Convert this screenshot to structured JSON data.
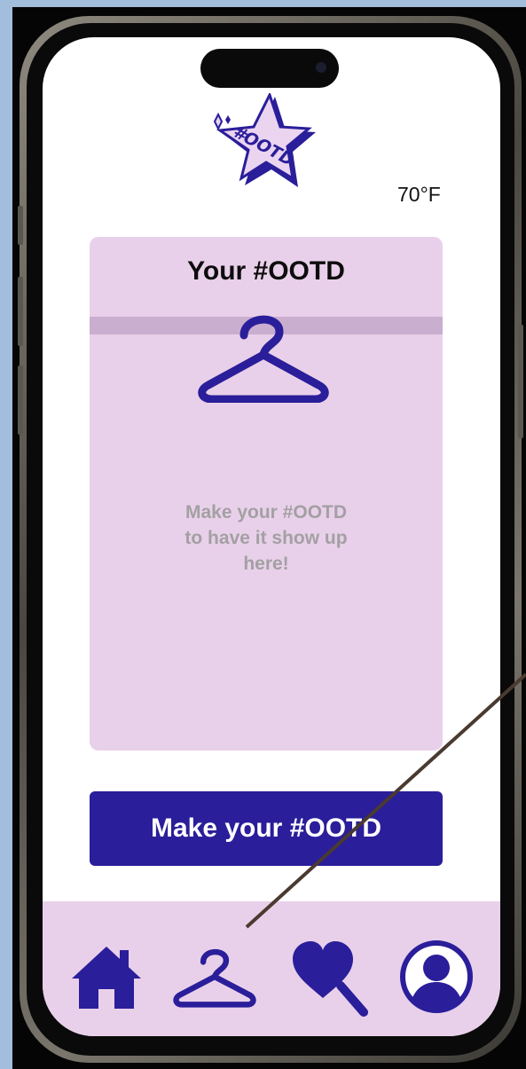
{
  "status": {
    "temperature": "70°F"
  },
  "logo": {
    "text": "#OOTD",
    "icon": "star-logo-icon"
  },
  "outfit_card": {
    "title": "Your #OOTD",
    "icon": "hanger-icon",
    "empty_message": "Make your #OOTD\nto have it show up\nhere!"
  },
  "primary_action": {
    "label": "Make your #OOTD"
  },
  "tabbar": {
    "tabs": [
      {
        "icon": "home-icon"
      },
      {
        "icon": "hanger-icon"
      },
      {
        "icon": "heart-search-icon"
      },
      {
        "icon": "profile-icon"
      }
    ]
  },
  "colors": {
    "accent": "#2a1e9a",
    "card_bg": "#e9d0ea",
    "rail": "#c9aed0",
    "muted_text": "#a3a0a3"
  }
}
